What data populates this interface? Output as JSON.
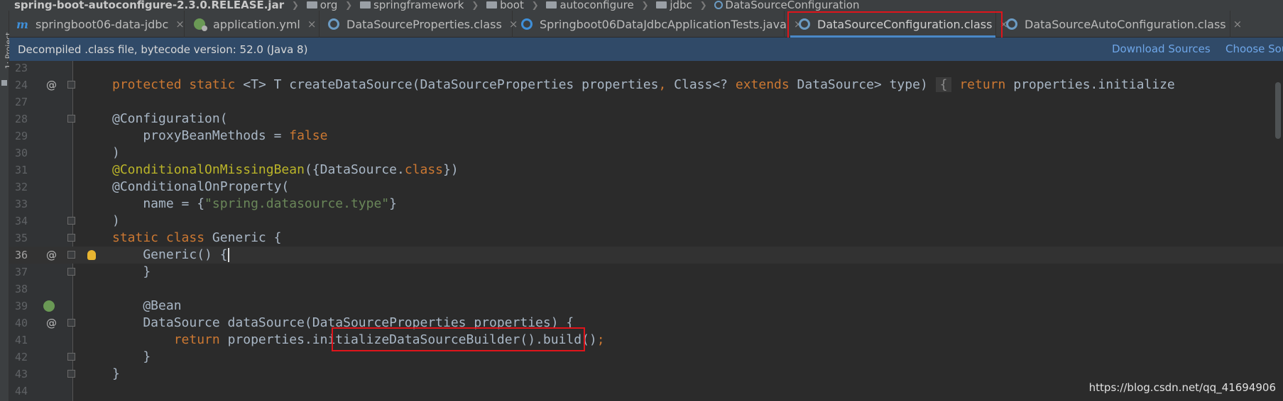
{
  "breadcrumb": {
    "jar": "spring-boot-autoconfigure-2.3.0.RELEASE.jar",
    "p1": "org",
    "p2": "springframework",
    "p3": "boot",
    "p4": "autoconfigure",
    "p5": "jdbc",
    "cls": "DataSourceConfiguration"
  },
  "toolwindow": {
    "label": "1: Project"
  },
  "tabs": [
    {
      "label": "springboot06-data-jdbc",
      "icon": "maven-m-icon"
    },
    {
      "label": "application.yml",
      "icon": "spring-yml-icon"
    },
    {
      "label": "DataSourceProperties.class",
      "icon": "class-icon"
    },
    {
      "label": "Springboot06DataJdbcApplicationTests.java",
      "icon": "test-class-icon"
    },
    {
      "label": "DataSourceConfiguration.class",
      "icon": "class-icon",
      "active": true
    },
    {
      "label": "DataSourceAutoConfiguration.class",
      "icon": "class-icon"
    }
  ],
  "tab_close": "×",
  "infobar": {
    "message": "Decompiled .class file, bytecode version: 52.0 (Java 8)",
    "download_sources": "Download Sources",
    "choose_sources": "Choose Sou"
  },
  "editor": {
    "lines": [
      {
        "num": "23"
      },
      {
        "num": "24"
      },
      {
        "num": "27"
      },
      {
        "num": "28"
      },
      {
        "num": "29"
      },
      {
        "num": "30"
      },
      {
        "num": "31"
      },
      {
        "num": "32"
      },
      {
        "num": "33"
      },
      {
        "num": "34"
      },
      {
        "num": "35"
      },
      {
        "num": "36"
      },
      {
        "num": "37"
      },
      {
        "num": "38"
      },
      {
        "num": "39"
      },
      {
        "num": "40"
      },
      {
        "num": "41"
      },
      {
        "num": "42"
      },
      {
        "num": "43"
      },
      {
        "num": "44"
      }
    ],
    "code": {
      "l24_kw1": "protected",
      "l24_kw2": "static",
      "l24_a": "<T> T createDataSource(DataSourceProperties properties",
      "l24_comma": ",",
      "l24_b": " Class<? ",
      "l24_kw3": "extends",
      "l24_c": " DataSource> type) ",
      "l24_brace": "{",
      "l24_kw4": "return",
      "l24_d": "properties.initialize",
      "l28": "@Configuration(",
      "l29_a": "    proxyBeanMethods = ",
      "l29_kw": "false",
      "l30": ")",
      "l31_a": "@ConditionalOnMissingBean",
      "l31_b": "({DataSource.",
      "l31_kw": "class",
      "l31_c": "})",
      "l32": "@ConditionalOnProperty(",
      "l33_a": "    name = {",
      "l33_str": "\"spring.datasource.type\"",
      "l33_b": "}",
      "l34": ")",
      "l35_kw1": "static",
      "l35_kw2": "class",
      "l35_a": " Generic {",
      "l36": "    Generic() {",
      "l37": "    }",
      "l39": "    @Bean",
      "l40": "    DataSource dataSource(DataSourceProperties properties) {",
      "l41_kw": "return",
      "l41_a": " properties.",
      "l41_m": "initializeDataSourceBuilder()",
      "l41_b": ".build()",
      "l41_semi": ";",
      "l42": "    }",
      "l43": "}"
    }
  },
  "gutter_marks": {
    "override": "@"
  },
  "watermark": "https://blog.csdn.net/qq_41694906"
}
